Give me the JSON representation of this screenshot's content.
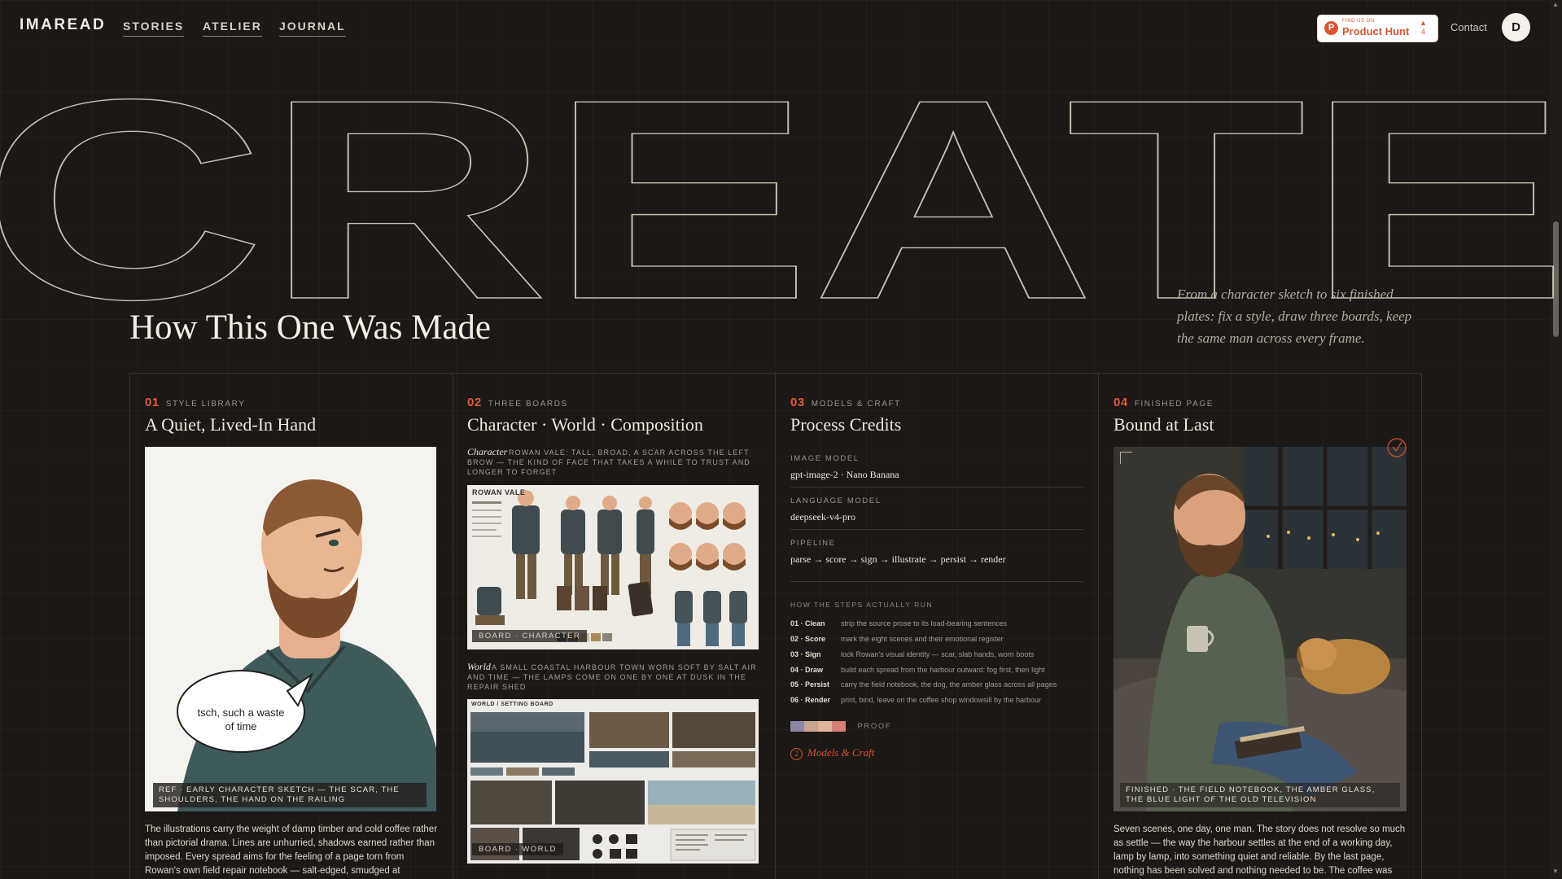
{
  "nav": {
    "brand": "IMAREAD",
    "links": [
      "STORIES",
      "ATELIER",
      "JOURNAL"
    ],
    "product_hunt_small": "FIND US ON",
    "product_hunt_label": "Product Hunt",
    "product_hunt_count": "4",
    "contact": "Contact",
    "avatar_initial": "D"
  },
  "hero": {
    "outline_word": "CREATE",
    "heading": "How This One Was Made",
    "intro": "From a character sketch to six finished plates: fix a style, draw three boards, keep the same man across every frame."
  },
  "columns": [
    {
      "num": "01",
      "kicker": "STYLE LIBRARY",
      "title": "A Quiet, Lived-In Hand",
      "speech": "tsch, such a waste of time",
      "caption": "REF · EARLY CHARACTER SKETCH — THE SCAR, THE SHOULDERS, THE HAND ON THE RAILING",
      "body": "The illustrations carry the weight of damp timber and cold coffee rather than pictorial drama. Lines are unhurried, shadows earned rather than imposed. Every spread aims for the feeling of a page torn from Rowan's own field repair notebook — salt-edged, smudged at"
    },
    {
      "num": "02",
      "kicker": "THREE BOARDS",
      "title": "Character · World · Composition",
      "char_label": "Character",
      "char_desc": "ROWAN VALE: TALL, BROAD, A SCAR ACROSS THE LEFT BROW — THE KIND OF FACE THAT TAKES A WHILE TO TRUST AND LONGER TO FORGET",
      "char_sheet_title": "ROWAN VALE",
      "char_tag": "BOARD · CHARACTER",
      "world_label": "World",
      "world_desc": "A SMALL COASTAL HARBOUR TOWN WORN SOFT BY SALT AIR AND TIME — THE LAMPS COME ON ONE BY ONE AT DUSK IN THE REPAIR SHED",
      "world_sheet_title": "WORLD / SETTING BOARD",
      "world_tag": "BOARD · WORLD"
    },
    {
      "num": "03",
      "kicker": "MODELS & CRAFT",
      "title": "Process Credits",
      "specs": [
        {
          "k": "IMAGE MODEL",
          "v": "gpt-image-2 · Nano Banana"
        },
        {
          "k": "LANGUAGE MODEL",
          "v": "deepseek-v4-pro"
        },
        {
          "k": "PIPELINE",
          "v": "parse → score → sign → illustrate → persist → render"
        }
      ],
      "steps_heading": "HOW THE STEPS ACTUALLY RUN",
      "steps": [
        {
          "k": "01 · Clean",
          "v": "strip the source prose to its load-bearing sentences"
        },
        {
          "k": "02 · Score",
          "v": "mark the eight scenes and their emotional register"
        },
        {
          "k": "03 · Sign",
          "v": "lock Rowan's visual identity — scar, slab hands, worn boots"
        },
        {
          "k": "04 · Draw",
          "v": "build each spread from the harbour outward: fog first, then light"
        },
        {
          "k": "05 · Persist",
          "v": "carry the field notebook, the dog, the amber glass across all pages"
        },
        {
          "k": "06 · Render",
          "v": "print, bind, leave on the coffee shop windowsill by the harbour"
        }
      ],
      "proof_label": "PROOF",
      "proof_swatches": [
        "#8d87a6",
        "#c9a58f",
        "#e0b49a",
        "#d77f75"
      ],
      "signature": "Models & Craft",
      "signature_mark": "2"
    },
    {
      "num": "04",
      "kicker": "FINISHED PAGE",
      "title": "Bound at Last",
      "caption": "FINISHED · THE FIELD NOTEBOOK, THE AMBER GLASS, THE BLUE LIGHT OF THE OLD TELEVISION",
      "body": "Seven scenes, one day, one man. The story does not resolve so much as settle — the way the harbour settles at the end of a working day, lamp by lamp, into something quiet and reliable. By the last page, nothing has been solved and nothing needed to be. The coffee was"
    }
  ],
  "colors": {
    "accent": "#e4593b",
    "background": "#1b1816",
    "outline": "#c9c0b3"
  }
}
